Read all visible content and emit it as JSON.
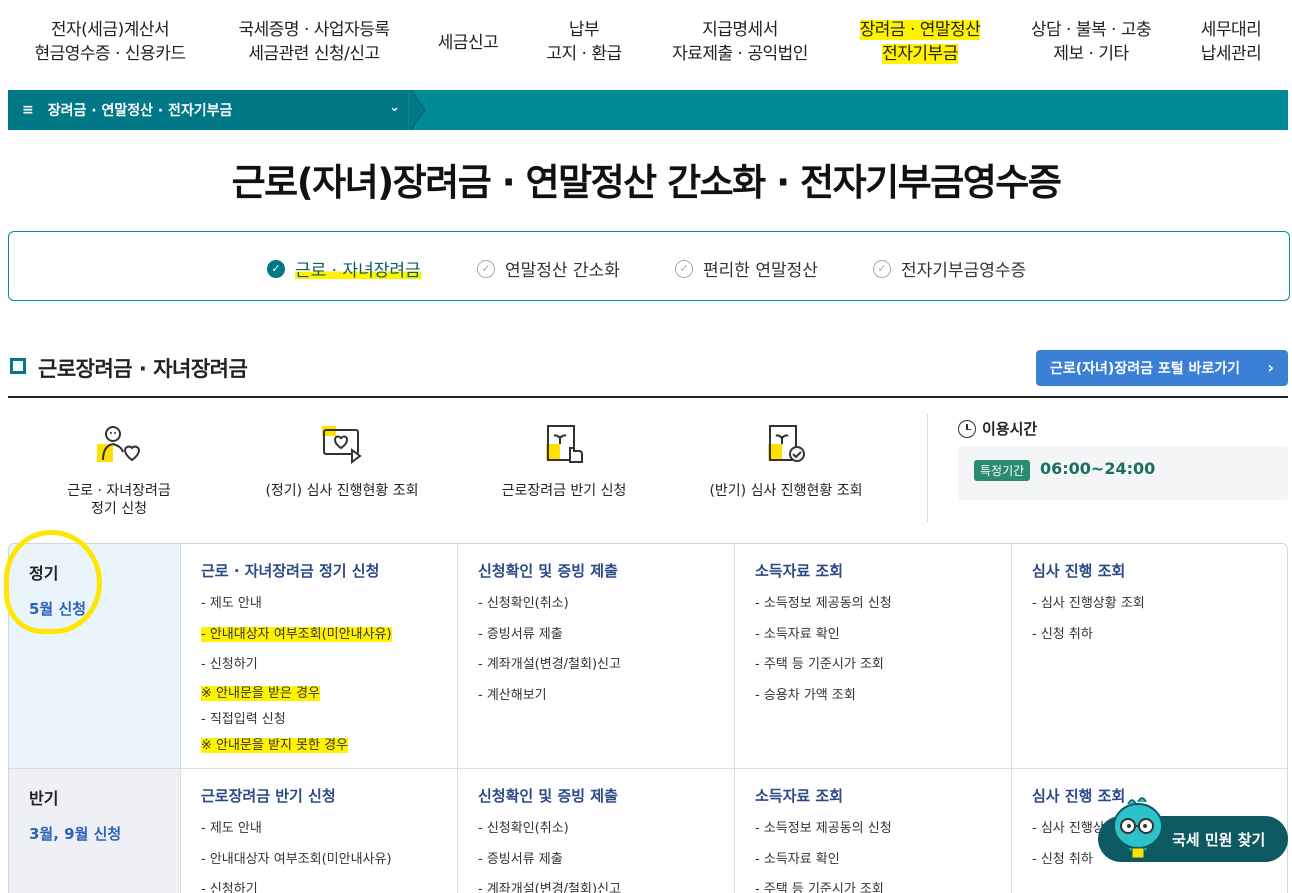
{
  "topnav": [
    {
      "line1": "전자(세금)계산서",
      "line2": "현금영수증 · 신용카드",
      "highlight": false
    },
    {
      "line1": "국세증명 · 사업자등록",
      "line2": "세금관련 신청/신고",
      "highlight": false
    },
    {
      "line1": "세금신고",
      "line2": "",
      "highlight": false
    },
    {
      "line1": "납부",
      "line2": "고지 · 환급",
      "highlight": false
    },
    {
      "line1": "지급명세서",
      "line2": "자료제출 · 공익법인",
      "highlight": false
    },
    {
      "line1": "장려금 · 연말정산",
      "line2": "전자기부금",
      "highlight": true
    },
    {
      "line1": "상담 · 불복 · 고충",
      "line2": "제보 · 기타",
      "highlight": false
    },
    {
      "line1": "세무대리",
      "line2": "납세관리",
      "highlight": false
    }
  ],
  "breadcrumb": {
    "label": "장려금 · 연말정산 · 전자기부금",
    "menu_icon": "hamburger-icon",
    "chevron_icon": "chevron-down-icon"
  },
  "page_title": "근로(자녀)장려금 · 연말정산 간소화 · 전자기부금영수증",
  "tabs": [
    {
      "label": "근로 · 자녀장려금",
      "active": true
    },
    {
      "label": "연말정산 간소화",
      "active": false
    },
    {
      "label": "편리한 연말정산",
      "active": false
    },
    {
      "label": "전자기부금영수증",
      "active": false
    }
  ],
  "section": {
    "title": "근로장려금 · 자녀장려금",
    "portal_button": "근로(자녀)장려금 포털 바로가기"
  },
  "quick_links": [
    {
      "label_line1": "근로 · 자녀장려금",
      "label_line2": "정기 신청",
      "icon": "person-heart-icon"
    },
    {
      "label_line1": "(정기) 심사 진행현황 조회",
      "label_line2": "",
      "icon": "monitor-heart-icon"
    },
    {
      "label_line1": "근로장려금 반기 신청",
      "label_line2": "",
      "icon": "document-hand-icon"
    },
    {
      "label_line1": "(반기) 심사 진행현황 조회",
      "label_line2": "",
      "icon": "document-check-icon"
    }
  ],
  "usage": {
    "title": "이용시간",
    "badge": "특정기간",
    "time": "06:00~24:00"
  },
  "table": {
    "rows": [
      {
        "head": "정기",
        "sub": "5월 신청",
        "cols": [
          {
            "title": "근로 · 자녀장려금 정기 신청",
            "items": [
              {
                "text": "- 제도 안내",
                "hl": false,
                "note": false
              },
              {
                "text": "- 안내대상자 여부조회(미안내사유)",
                "hl": true,
                "note": false
              },
              {
                "text": "- 신청하기",
                "hl": false,
                "note": false
              },
              {
                "text": "※ 안내문을 받은 경우",
                "hl": true,
                "note": true
              },
              {
                "text": "- 직접입력 신청",
                "hl": false,
                "note": true
              },
              {
                "text": "※ 안내문을 받지 못한 경우",
                "hl": true,
                "note": true
              }
            ]
          },
          {
            "title": "신청확인 및 증빙 제출",
            "items": [
              {
                "text": "- 신청확인(취소)",
                "hl": false,
                "note": false
              },
              {
                "text": "- 증빙서류 제출",
                "hl": false,
                "note": false
              },
              {
                "text": "- 계좌개설(변경/철회)신고",
                "hl": false,
                "note": false
              },
              {
                "text": "- 계산해보기",
                "hl": false,
                "note": false
              }
            ]
          },
          {
            "title": "소득자료 조회",
            "items": [
              {
                "text": "- 소득정보 제공동의 신청",
                "hl": false,
                "note": false
              },
              {
                "text": "- 소득자료 확인",
                "hl": false,
                "note": false
              },
              {
                "text": "- 주택 등 기준시가 조회",
                "hl": false,
                "note": false
              },
              {
                "text": "- 승용차 가액 조회",
                "hl": false,
                "note": false
              }
            ]
          },
          {
            "title": "심사 진행 조회",
            "items": [
              {
                "text": "- 심사 진행상황 조회",
                "hl": false,
                "note": false
              },
              {
                "text": "- 신청 취하",
                "hl": false,
                "note": false
              }
            ]
          }
        ]
      },
      {
        "head": "반기",
        "sub": "3월, 9월 신청",
        "cols": [
          {
            "title": "근로장려금 반기 신청",
            "items": [
              {
                "text": "- 제도 안내",
                "hl": false,
                "note": false
              },
              {
                "text": "- 안내대상자 여부조회(미안내사유)",
                "hl": false,
                "note": false
              },
              {
                "text": "- 신청하기",
                "hl": false,
                "note": false
              }
            ]
          },
          {
            "title": "신청확인 및 증빙 제출",
            "items": [
              {
                "text": "- 신청확인(취소)",
                "hl": false,
                "note": false
              },
              {
                "text": "- 증빙서류 제출",
                "hl": false,
                "note": false
              },
              {
                "text": "- 계좌개설(변경/철회)신고",
                "hl": false,
                "note": false
              }
            ]
          },
          {
            "title": "소득자료 조회",
            "items": [
              {
                "text": "- 소득정보 제공동의 신청",
                "hl": false,
                "note": false
              },
              {
                "text": "- 소득자료 확인",
                "hl": false,
                "note": false
              },
              {
                "text": "- 주택 등 기준시가 조회",
                "hl": false,
                "note": false
              }
            ]
          },
          {
            "title": "심사 진행 조회",
            "items": [
              {
                "text": "- 심사 진행상황 조회",
                "hl": false,
                "note": false
              },
              {
                "text": "- 신청 취하",
                "hl": false,
                "note": false
              }
            ]
          }
        ]
      }
    ]
  },
  "float_button": {
    "label": "국세 민원 찾기",
    "icon": "mascot-icon"
  },
  "colors": {
    "teal": "#008a96",
    "teal_dark": "#007885",
    "blue_button": "#3b7fd6",
    "highlight": "#fff200",
    "link_blue": "#2a63b8"
  }
}
